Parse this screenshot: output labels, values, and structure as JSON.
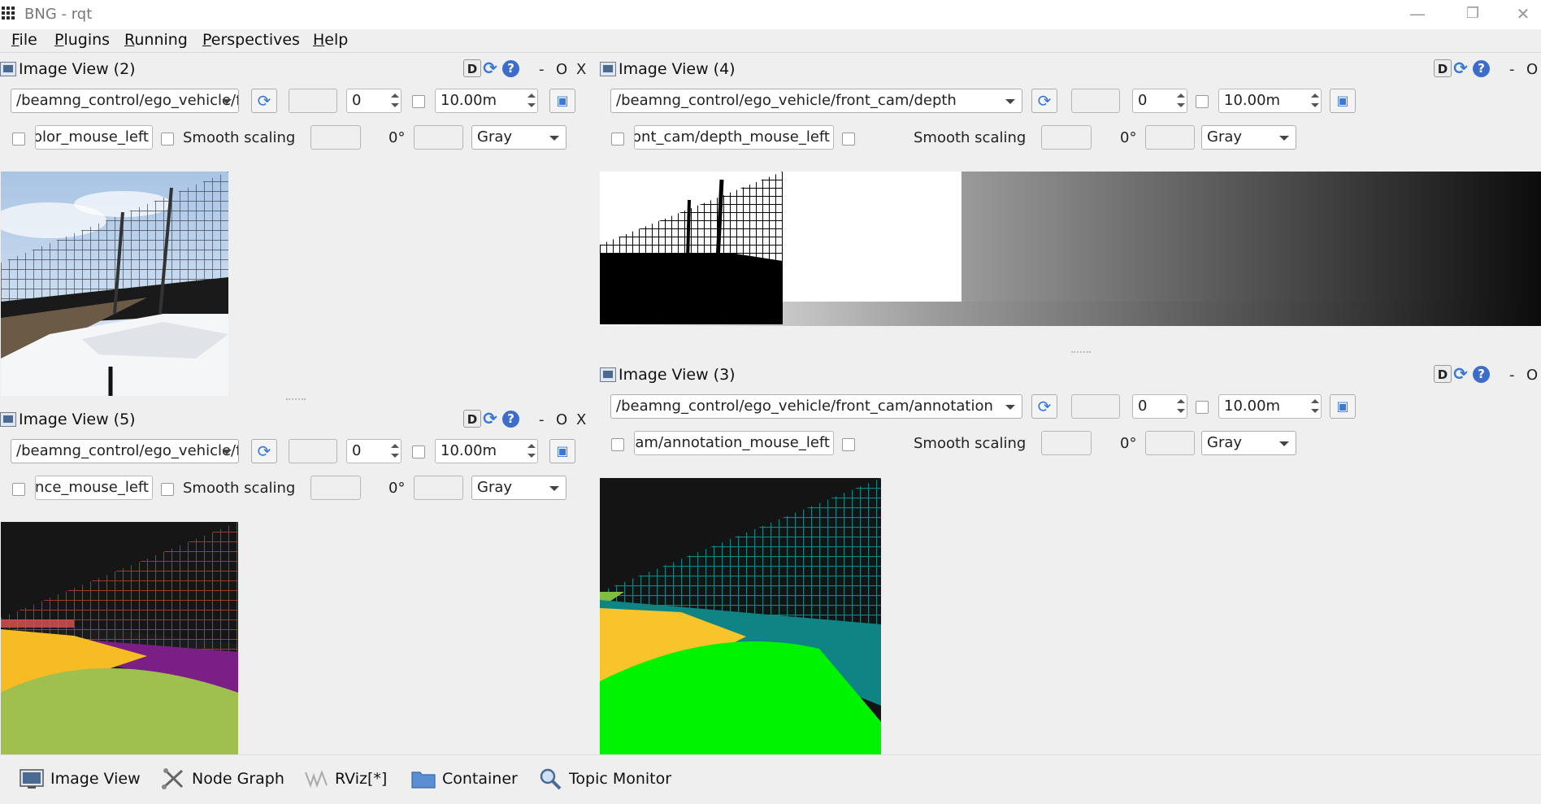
{
  "window": {
    "title": "BNG - rqt",
    "controls": {
      "minimize": "—",
      "restore": "❐",
      "close": "✕"
    }
  },
  "menu": [
    "File",
    "Plugins",
    "Running",
    "Perspectives",
    "Help"
  ],
  "panel_common": {
    "title_buttons": {
      "d": "D",
      "refresh": "⟳",
      "help": "?",
      "minus": "-",
      "o": "O",
      "x": "X"
    },
    "smooth_label": "Smooth scaling",
    "rotation": "0°",
    "colormap": "Gray",
    "zero": "0",
    "max_range": "10.00m"
  },
  "panels": {
    "view2": {
      "title": "Image View (2)",
      "topic": "/beamng_control/ego_vehicle/front_cam/color",
      "mouse_topic": "olor_mouse_left",
      "image": "color camera view of fence and road"
    },
    "view4": {
      "title": "Image View (4)",
      "topic": "/beamng_control/ego_vehicle/front_cam/depth",
      "mouse_topic": "icle/front_cam/depth_mouse_left",
      "image": "depth image with gradient"
    },
    "view5": {
      "title": "Image View (5)",
      "topic": "/beamng_control/ego_vehicle/front_cam/instance",
      "mouse_topic": "nce_mouse_left",
      "image": "instance segmentation"
    },
    "view3": {
      "title": "Image View (3)",
      "topic": "/beamng_control/ego_vehicle/front_cam/annotation",
      "mouse_topic": "front_cam/annotation_mouse_left",
      "image": "annotation segmentation"
    }
  },
  "bottom_bar": [
    {
      "label": "Image View",
      "icon": "image-view-icon"
    },
    {
      "label": "Node Graph",
      "icon": "node-graph-icon"
    },
    {
      "label": "RViz[*]",
      "icon": "rviz-icon"
    },
    {
      "label": "Container",
      "icon": "folder-icon"
    },
    {
      "label": "Topic Monitor",
      "icon": "magnifier-icon"
    }
  ],
  "colors": {
    "accent": "#3a78d8",
    "background": "#efefef"
  }
}
